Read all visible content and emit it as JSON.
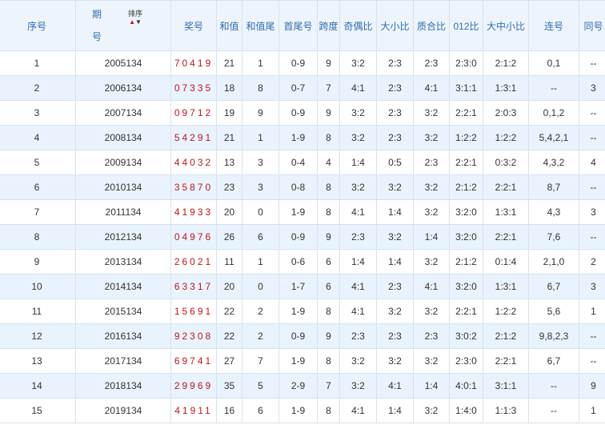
{
  "headers": {
    "index": "序号",
    "period_top": "期",
    "period_bottom": "号",
    "sort_label": "排序",
    "number": "奖号",
    "sum": "和值",
    "sum_tail": "和值尾",
    "first_last": "首尾号",
    "span": "跨度",
    "odd_even": "奇偶比",
    "big_small": "大小比",
    "prime_composite": "质合比",
    "mod012": "012比",
    "big_mid_small": "大中小比",
    "consecutive": "连号",
    "same": "同号"
  },
  "rows": [
    {
      "index": "1",
      "period": "2005134",
      "number": "70419",
      "sum": "21",
      "sum_tail": "1",
      "first_last": "0-9",
      "span": "9",
      "odd_even": "3:2",
      "big_small": "2:3",
      "prime_composite": "2:3",
      "mod012": "2:3:0",
      "big_mid_small": "2:1:2",
      "consecutive": "0,1",
      "same": "--"
    },
    {
      "index": "2",
      "period": "2006134",
      "number": "07335",
      "sum": "18",
      "sum_tail": "8",
      "first_last": "0-7",
      "span": "7",
      "odd_even": "4:1",
      "big_small": "2:3",
      "prime_composite": "4:1",
      "mod012": "3:1:1",
      "big_mid_small": "1:3:1",
      "consecutive": "--",
      "same": "3"
    },
    {
      "index": "3",
      "period": "2007134",
      "number": "09712",
      "sum": "19",
      "sum_tail": "9",
      "first_last": "0-9",
      "span": "9",
      "odd_even": "3:2",
      "big_small": "2:3",
      "prime_composite": "3:2",
      "mod012": "2:2:1",
      "big_mid_small": "2:0:3",
      "consecutive": "0,1,2",
      "same": "--"
    },
    {
      "index": "4",
      "period": "2008134",
      "number": "54291",
      "sum": "21",
      "sum_tail": "1",
      "first_last": "1-9",
      "span": "8",
      "odd_even": "3:2",
      "big_small": "2:3",
      "prime_composite": "3:2",
      "mod012": "1:2:2",
      "big_mid_small": "1:2:2",
      "consecutive": "5,4,2,1",
      "same": "--"
    },
    {
      "index": "5",
      "period": "2009134",
      "number": "44032",
      "sum": "13",
      "sum_tail": "3",
      "first_last": "0-4",
      "span": "4",
      "odd_even": "1:4",
      "big_small": "0:5",
      "prime_composite": "2:3",
      "mod012": "2:2:1",
      "big_mid_small": "0:3:2",
      "consecutive": "4,3,2",
      "same": "4"
    },
    {
      "index": "6",
      "period": "2010134",
      "number": "35870",
      "sum": "23",
      "sum_tail": "3",
      "first_last": "0-8",
      "span": "8",
      "odd_even": "3:2",
      "big_small": "3:2",
      "prime_composite": "3:2",
      "mod012": "2:1:2",
      "big_mid_small": "2:2:1",
      "consecutive": "8,7",
      "same": "--"
    },
    {
      "index": "7",
      "period": "2011134",
      "number": "41933",
      "sum": "20",
      "sum_tail": "0",
      "first_last": "1-9",
      "span": "8",
      "odd_even": "4:1",
      "big_small": "1:4",
      "prime_composite": "3:2",
      "mod012": "3:2:0",
      "big_mid_small": "1:3:1",
      "consecutive": "4,3",
      "same": "3"
    },
    {
      "index": "8",
      "period": "2012134",
      "number": "04976",
      "sum": "26",
      "sum_tail": "6",
      "first_last": "0-9",
      "span": "9",
      "odd_even": "2:3",
      "big_small": "3:2",
      "prime_composite": "1:4",
      "mod012": "3:2:0",
      "big_mid_small": "2:2:1",
      "consecutive": "7,6",
      "same": "--"
    },
    {
      "index": "9",
      "period": "2013134",
      "number": "26021",
      "sum": "11",
      "sum_tail": "1",
      "first_last": "0-6",
      "span": "6",
      "odd_even": "1:4",
      "big_small": "1:4",
      "prime_composite": "3:2",
      "mod012": "2:1:2",
      "big_mid_small": "0:1:4",
      "consecutive": "2,1,0",
      "same": "2"
    },
    {
      "index": "10",
      "period": "2014134",
      "number": "63317",
      "sum": "20",
      "sum_tail": "0",
      "first_last": "1-7",
      "span": "6",
      "odd_even": "4:1",
      "big_small": "2:3",
      "prime_composite": "4:1",
      "mod012": "3:2:0",
      "big_mid_small": "1:3:1",
      "consecutive": "6,7",
      "same": "3"
    },
    {
      "index": "11",
      "period": "2015134",
      "number": "15691",
      "sum": "22",
      "sum_tail": "2",
      "first_last": "1-9",
      "span": "8",
      "odd_even": "4:1",
      "big_small": "3:2",
      "prime_composite": "3:2",
      "mod012": "2:2:1",
      "big_mid_small": "1:2:2",
      "consecutive": "5,6",
      "same": "1"
    },
    {
      "index": "12",
      "period": "2016134",
      "number": "92308",
      "sum": "22",
      "sum_tail": "2",
      "first_last": "0-9",
      "span": "9",
      "odd_even": "2:3",
      "big_small": "2:3",
      "prime_composite": "2:3",
      "mod012": "3:0:2",
      "big_mid_small": "2:1:2",
      "consecutive": "9,8,2,3",
      "same": "--"
    },
    {
      "index": "13",
      "period": "2017134",
      "number": "69741",
      "sum": "27",
      "sum_tail": "7",
      "first_last": "1-9",
      "span": "8",
      "odd_even": "3:2",
      "big_small": "3:2",
      "prime_composite": "3:2",
      "mod012": "2:3:0",
      "big_mid_small": "2:2:1",
      "consecutive": "6,7",
      "same": "--"
    },
    {
      "index": "14",
      "period": "2018134",
      "number": "29969",
      "sum": "35",
      "sum_tail": "5",
      "first_last": "2-9",
      "span": "7",
      "odd_even": "3:2",
      "big_small": "4:1",
      "prime_composite": "1:4",
      "mod012": "4:0:1",
      "big_mid_small": "3:1:1",
      "consecutive": "--",
      "same": "9"
    },
    {
      "index": "15",
      "period": "2019134",
      "number": "41911",
      "sum": "16",
      "sum_tail": "6",
      "first_last": "1-9",
      "span": "8",
      "odd_even": "4:1",
      "big_small": "1:4",
      "prime_composite": "3:2",
      "mod012": "1:4:0",
      "big_mid_small": "1:1:3",
      "consecutive": "--",
      "same": "1"
    }
  ],
  "colors": {
    "header_text": "#2f6eb3",
    "header_bg": "#eef4fb",
    "row_stripe": "#e8f3fd",
    "number_red": "#c0141b",
    "border": "#d6e2ee"
  },
  "icons": {
    "sort_up": "up-triangle-red",
    "sort_down": "down-triangle-black"
  }
}
